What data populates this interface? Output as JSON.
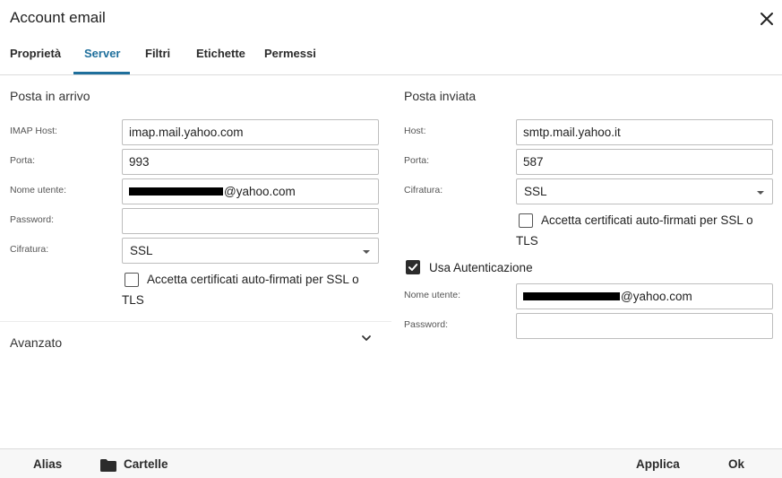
{
  "dialog": {
    "title": "Account email"
  },
  "tabs": [
    {
      "label": "Proprietà"
    },
    {
      "label": "Server"
    },
    {
      "label": "Filtri"
    },
    {
      "label": "Etichette"
    },
    {
      "label": "Permessi"
    }
  ],
  "incoming": {
    "title": "Posta in arrivo",
    "imap_host_label": "IMAP Host:",
    "imap_host_value": "imap.mail.yahoo.com",
    "port_label": "Porta:",
    "port_value": "993",
    "username_label": "Nome utente:",
    "username_suffix": "@yahoo.com",
    "password_label": "Password:",
    "password_value": "",
    "encryption_label": "Cifratura:",
    "encryption_value": "SSL",
    "self_signed_label": "Accetta certificati auto-firmati per SSL o",
    "self_signed_label_2": "TLS",
    "self_signed_checked": false
  },
  "outgoing": {
    "title": "Posta inviata",
    "host_label": "Host:",
    "host_value": "smtp.mail.yahoo.it",
    "port_label": "Porta:",
    "port_value": "587",
    "encryption_label": "Cifratura:",
    "encryption_value": "SSL",
    "self_signed_label": "Accetta certificati auto-firmati per SSL o",
    "self_signed_label_2": "TLS",
    "self_signed_checked": false,
    "use_auth_label": "Usa Autenticazione",
    "use_auth_checked": true,
    "username_label": "Nome utente:",
    "username_suffix": "@yahoo.com",
    "password_label": "Password:",
    "password_value": ""
  },
  "advanced": {
    "label": "Avanzato"
  },
  "footer": {
    "alias_label": "Alias",
    "folders_label": "Cartelle",
    "apply_label": "Applica",
    "ok_label": "Ok"
  },
  "icons": {
    "close": "close-icon",
    "chevron": "chevron-down-icon",
    "folder": "folder-icon",
    "check": "checkmark-icon"
  },
  "colors": {
    "accent": "#1f6f9c",
    "text": "#222222",
    "border": "#bdbdbd"
  }
}
